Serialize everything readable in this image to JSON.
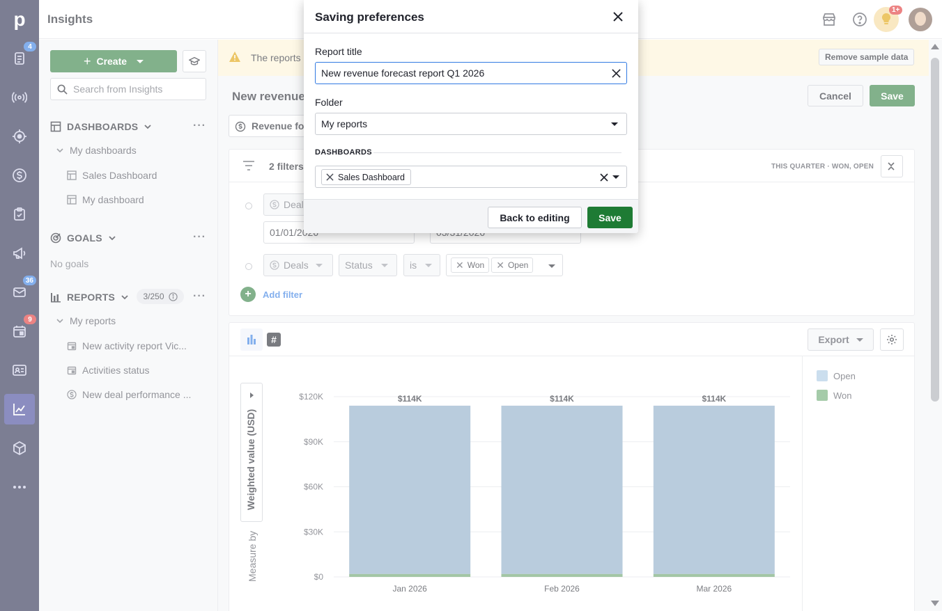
{
  "app": {
    "title": "Insights"
  },
  "rail": {
    "items": [
      {
        "name": "leads",
        "badge": "4"
      },
      {
        "name": "deals-pipeline",
        "badge": ""
      },
      {
        "name": "campaigns-signal",
        "badge": ""
      },
      {
        "name": "deals",
        "badge": ""
      },
      {
        "name": "activities",
        "badge": ""
      },
      {
        "name": "campaigns",
        "badge": ""
      },
      {
        "name": "mail",
        "badge": "36"
      },
      {
        "name": "calendar",
        "badge": "9"
      },
      {
        "name": "contacts",
        "badge": ""
      },
      {
        "name": "insights",
        "badge": ""
      },
      {
        "name": "products",
        "badge": ""
      },
      {
        "name": "more",
        "badge": ""
      }
    ]
  },
  "topbar": {
    "tips_badge": "1+"
  },
  "sidebar": {
    "create_label": "Create",
    "search_placeholder": "Search from Insights",
    "dashboards_header": "DASHBOARDS",
    "my_dashboards": "My dashboards",
    "dashboards": [
      "Sales Dashboard",
      "My dashboard"
    ],
    "goals_header": "GOALS",
    "no_goals": "No goals",
    "reports_header": "REPORTS",
    "reports_counter": "3/250",
    "my_reports": "My reports",
    "reports": [
      "New activity report Vic...",
      "Activities status",
      "New deal performance ..."
    ]
  },
  "main": {
    "banner_text": "The reports",
    "remove_sample": "Remove sample data",
    "report_title": "New revenue",
    "cancel": "Cancel",
    "save": "Save",
    "report_tab": "Revenue fo",
    "filters_title": "2 filters",
    "filters_summary_period": "THIS QUARTER",
    "filters_summary_status": "WON, OPEN",
    "filter1_entity": "Deal",
    "filter1_from": "01/01/2026",
    "filter1_to": "03/31/2026",
    "filter2_entity": "Deals",
    "filter2_field": "Status",
    "filter2_op": "is",
    "filter2_values": [
      "Won",
      "Open"
    ],
    "add_filter": "Add filter",
    "export": "Export",
    "y_axis_label": "Weighted value (USD)",
    "measure_by": "Measure by"
  },
  "chart_data": {
    "type": "bar",
    "stacked": true,
    "categories": [
      "Jan 2026",
      "Feb 2026",
      "Mar 2026"
    ],
    "series": [
      {
        "name": "Won",
        "values": [
          2,
          2,
          2
        ],
        "color": "#66a06a"
      },
      {
        "name": "Open",
        "values": [
          112,
          112,
          112
        ],
        "color": "#8aabc6"
      }
    ],
    "totals_labels": [
      "$114K",
      "$114K",
      "$114K"
    ],
    "y_ticks": [
      "$0",
      "$30K",
      "$60K",
      "$90K",
      "$120K"
    ],
    "ylim": [
      0,
      120
    ],
    "ylabel": "Weighted value (USD)",
    "legend": [
      "Open",
      "Won"
    ],
    "legend_colors": [
      "#a8c8e3",
      "#6aa870"
    ],
    "legend_position": "right",
    "grid": true
  },
  "modal": {
    "title": "Saving preferences",
    "report_title_label": "Report title",
    "report_title_value": "New revenue forecast report Q1 2026",
    "folder_label": "Folder",
    "folder_value": "My reports",
    "dashboards_label": "DASHBOARDS",
    "dashboard_chip": "Sales Dashboard",
    "back": "Back to editing",
    "save": "Save"
  }
}
